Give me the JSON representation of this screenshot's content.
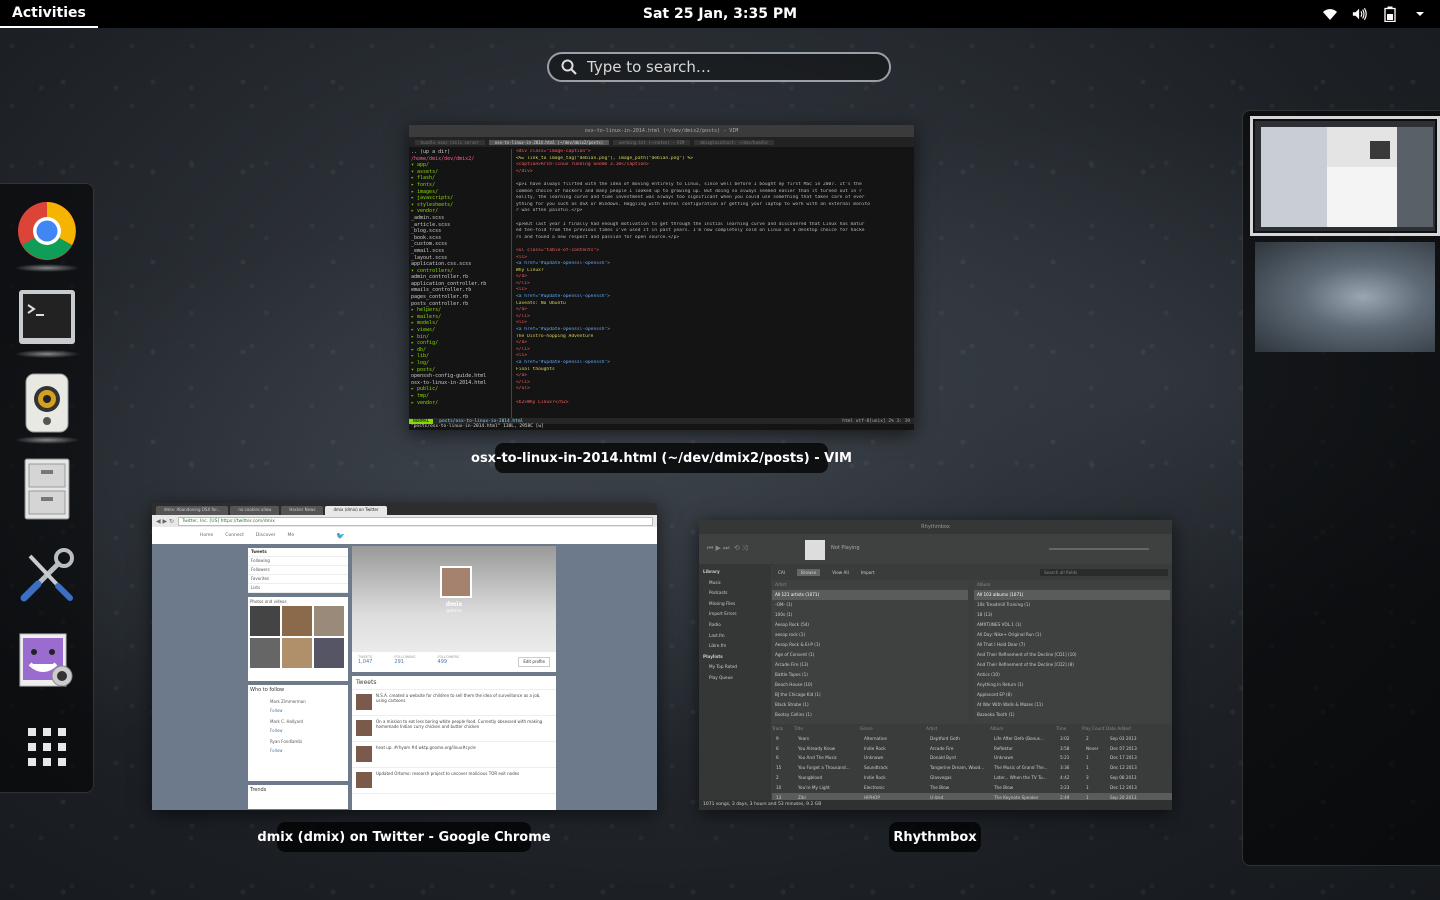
{
  "topbar": {
    "activities_label": "Activities",
    "clock": "Sat 25 Jan,  3:35 PM",
    "tray": [
      "network-wireless-icon",
      "volume-icon",
      "battery-icon",
      "menu-arrow-icon"
    ]
  },
  "search": {
    "placeholder": "Type to search…"
  },
  "dash": {
    "apps": [
      {
        "name": "Google Chrome",
        "icon": "chrome-icon",
        "running": true
      },
      {
        "name": "Terminal",
        "icon": "terminal-icon",
        "running": true
      },
      {
        "name": "Rhythmbox",
        "icon": "rhythmbox-icon",
        "running": true
      },
      {
        "name": "Files",
        "icon": "files-cabinet-icon",
        "running": false
      },
      {
        "name": "System Settings",
        "icon": "tools-icon",
        "running": false
      },
      {
        "name": "Cheese",
        "icon": "cheese-webcam-icon",
        "running": false
      }
    ],
    "show_apps_icon": "grid-icon"
  },
  "windows": {
    "vim": {
      "caption": "osx-to-linux-in-2014.html (~/dev/dmix2/posts) - VIM",
      "titlebar": "osx-to-linux-in-2014.html (~/dev/dmix2/posts) - VIM",
      "tabs": [
        "bundle exec rails server",
        "osx-to-linux-in-2014.html (~/dev/dmix2/posts)",
        "working.txt (~/notes) - VIM",
        "dmix@localhost: ~/dev/bundle"
      ],
      "tree": [
        {
          "t": ".. (up a dir)",
          "c": "f"
        },
        {
          "t": "/home/dmix/dev/dmix2/",
          "c": "t"
        },
        {
          "t": "▾ app/",
          "c": "d"
        },
        {
          "t": "  ▾ assets/",
          "c": "d"
        },
        {
          "t": "    ▸ flash/",
          "c": "d"
        },
        {
          "t": "    ▸ fonts/",
          "c": "d"
        },
        {
          "t": "    ▸ images/",
          "c": "d"
        },
        {
          "t": "    ▸ javascripts/",
          "c": "d"
        },
        {
          "t": "    ▾ stylesheets/",
          "c": "d"
        },
        {
          "t": "      ▸ vendor/",
          "c": "d"
        },
        {
          "t": "        _admin.scss",
          "c": "f"
        },
        {
          "t": "        _article.scss",
          "c": "f"
        },
        {
          "t": "        _blog.scss",
          "c": "f"
        },
        {
          "t": "        _book.scss",
          "c": "f"
        },
        {
          "t": "        _custom.scss",
          "c": "f"
        },
        {
          "t": "        _email.scss",
          "c": "f"
        },
        {
          "t": "        _layout.scss",
          "c": "f"
        },
        {
          "t": "        application.css.scss",
          "c": "f"
        },
        {
          "t": "  ▾ controllers/",
          "c": "d"
        },
        {
          "t": "      admin_controller.rb",
          "c": "f"
        },
        {
          "t": "      application_controller.rb",
          "c": "f"
        },
        {
          "t": "      emails_controller.rb",
          "c": "f"
        },
        {
          "t": "      pages_controller.rb",
          "c": "f"
        },
        {
          "t": "      posts_controller.rb",
          "c": "f"
        },
        {
          "t": "  ▸ helpers/",
          "c": "d"
        },
        {
          "t": "  ▸ mailers/",
          "c": "d"
        },
        {
          "t": "  ▸ models/",
          "c": "d"
        },
        {
          "t": "  ▸ views/",
          "c": "d"
        },
        {
          "t": "▸ bin/",
          "c": "d"
        },
        {
          "t": "▸ config/",
          "c": "d"
        },
        {
          "t": "▸ db/",
          "c": "d"
        },
        {
          "t": "▸ lib/",
          "c": "d"
        },
        {
          "t": "▸ log/",
          "c": "d"
        },
        {
          "t": "▾ posts/",
          "c": "d"
        },
        {
          "t": "    openssh-config-guide.html",
          "c": "f"
        },
        {
          "t": "    osx-to-linux-in-2014.html",
          "c": "f"
        },
        {
          "t": "▸ public/",
          "c": "d"
        },
        {
          "t": "▸ tmp/",
          "c": "d"
        },
        {
          "t": "▸ vendor/",
          "c": "d"
        }
      ],
      "code": [
        {
          "t": "<div class=\"image-caption\">",
          "c": "t"
        },
        {
          "t": "  <%= link_to image_tag(\"debian.png\"), image_path(\"debian.png\") %>",
          "c": "s"
        },
        {
          "t": "  <caption>Arch-linux running Gnome 3.10</caption>",
          "c": "t"
        },
        {
          "t": "</div>",
          "c": "t"
        },
        {
          "t": "",
          "c": ""
        },
        {
          "t": "<p>I have always flirted with the idea of moving entirely to Linux, since well before I bought my first Mac in 2007.  It's the",
          "c": ""
        },
        {
          "t": " common choice of hackers and many people I looked up to growing up. But doing so always seemed easier than it turned out in r",
          "c": ""
        },
        {
          "t": "eality, the learning curve and time investment was always too significant when you could use something that takes care of ever",
          "c": ""
        },
        {
          "t": "ything for you such as OSX or Windows. Haggling with kernel configuration or getting your laptop to work with an external monito",
          "c": ""
        },
        {
          "t": "r was often painful.</p>",
          "c": ""
        },
        {
          "t": "",
          "c": ""
        },
        {
          "t": "<p>But last year I finally had enough motivation to get through the initial learning curve and discovered that Linux has matur",
          "c": ""
        },
        {
          "t": "ed ten-fold from the previous times I've used it in past years. I'm now completely sold on Linux as a desktop choice for hacke",
          "c": ""
        },
        {
          "t": "rs and found a new respect and passion for open source.</p>",
          "c": ""
        },
        {
          "t": "",
          "c": ""
        },
        {
          "t": "<ul class=\"table-of-contents\">",
          "c": "t"
        },
        {
          "t": "  <li>",
          "c": "t"
        },
        {
          "t": "    <a href=\"#update-openssl-openssh\">",
          "c": "a"
        },
        {
          "t": "      Why Linux?",
          "c": "s"
        },
        {
          "t": "    </a>",
          "c": "t"
        },
        {
          "t": "  </li>",
          "c": "t"
        },
        {
          "t": "  <li>",
          "c": "t"
        },
        {
          "t": "    <a href=\"#update-openssl-openssh\">",
          "c": "a"
        },
        {
          "t": "      Caveats: No Ubuntu",
          "c": "s"
        },
        {
          "t": "    </a>",
          "c": "t"
        },
        {
          "t": "  </li>",
          "c": "t"
        },
        {
          "t": "  <li>",
          "c": "t"
        },
        {
          "t": "    <a href=\"#update-openssl-openssh\">",
          "c": "a"
        },
        {
          "t": "      The Distro-hopping Adventure",
          "c": "s"
        },
        {
          "t": "    </a>",
          "c": "t"
        },
        {
          "t": "  </li>",
          "c": "t"
        },
        {
          "t": "  <li>",
          "c": "t"
        },
        {
          "t": "    <a href=\"#update-openssl-openssh\">",
          "c": "a"
        },
        {
          "t": "      Final thoughts",
          "c": "s"
        },
        {
          "t": "    </a>",
          "c": "t"
        },
        {
          "t": "  </li>",
          "c": "t"
        },
        {
          "t": "</ul>",
          "c": "t"
        },
        {
          "t": "",
          "c": ""
        },
        {
          "t": "<h2>Why Linux?</h2>",
          "c": "t"
        }
      ],
      "status_mode": "NORMAL",
      "status_file": "posts/osx-to-linux-in-2014.html",
      "status_right": "html  utf-8[unix]  2%  3: 19",
      "cmdline": "\"posts/osx-to-linux-in-2014.html\" 138L, 2958C [w]"
    },
    "chrome": {
      "caption": "dmix (dmix) on Twitter - Google Chrome",
      "tabs": [
        "dmix: Abandoning OSX for...",
        "no cookies allow",
        "Hacker News",
        "dmix (dmix) on Twitter"
      ],
      "url": "Twitter, Inc. [US] https://twitter.com/dmix",
      "nav": [
        "Home",
        "Connect",
        "Discover",
        "Me"
      ],
      "sidebar": [
        "Tweets",
        "Following",
        "Followers",
        "Favorites",
        "Lists"
      ],
      "photos_label": "Photos and videos",
      "who_to_follow": "Who to follow",
      "follow_people": [
        "Mark Zimmerman",
        "Mark C. Hallyard",
        "Ryan Fondlambi"
      ],
      "follow_label": "Follow",
      "trends_label": "Trends",
      "profile_name": "dmix",
      "profile_handle": "@dmix",
      "stats": [
        {
          "label": "TWEETS",
          "value": "1,047"
        },
        {
          "label": "FOLLOWING",
          "value": "291"
        },
        {
          "label": "FOLLOWERS",
          "value": "499"
        }
      ],
      "edit_profile": "Edit profile",
      "tweets_label": "Tweets",
      "tweets": [
        "N.S.A. created a website for children to sell them the idea of surveillance as a job, using cartoons",
        "On a mission to eat less boring white people food. Currently obsessed with making homemade Indian curry chicken and butter chicken",
        "heat up. #rhyam #4 wktp.gnome.org/linux#cycle",
        "Updated Ortomo: research project to uncover malicious TOR exit nodes"
      ]
    },
    "rhythmbox": {
      "caption": "Rhythmbox",
      "titlebar": "Rhythmbox",
      "now_playing": "Not Playing",
      "library": [
        "Library",
        "Music",
        "Podcasts",
        "Missing Files",
        "Import Errors",
        "Radio",
        "Last.fm",
        "Libre.fm",
        "Playlists",
        "My Top Rated",
        "Play Queue"
      ],
      "browse_tabs": [
        "CAI",
        "Browse",
        "View All",
        "Import"
      ],
      "search_placeholder": "Search all fields",
      "artist_header": "Artist",
      "album_header": "Album",
      "artists": [
        "All 121 artists (1071)",
        "-OM- (1)",
        "100s (1)",
        "Aesop Rock (54)",
        "aesop rock (1)",
        "Aesop Rock & El-P (1)",
        "Age of Consent (1)",
        "Arcade Fire (13)",
        "Battle Tapes (1)",
        "Beach House (10)",
        "BJ the Chicago Kid (1)",
        "Black Strobe (1)",
        "Bootsy Collins (1)"
      ],
      "albums": [
        "All 103 albums (1071)",
        "10k Treadmill Training (1)",
        "18 (13)",
        "AMXTUNES VOL.1 (1)",
        "All Day: Nike+ Original Run (1)",
        "All That I Hold Dear (7)",
        "And Their Refinement of the Decline [CD1] (10)",
        "And Their Refinement of the Decline [CD2] (8)",
        "Antics (10)",
        "Anything In Return (1)",
        "Applecord EP (8)",
        "At War With Walls & Mazes (11)",
        "Bazooka Tooth (1)"
      ],
      "track_headers": [
        "Track",
        "Title",
        "Genre",
        "Artist",
        "Album",
        "Time",
        "Play Count",
        "Date Added"
      ],
      "tracks": [
        [
          "9",
          "Years",
          "Alternative",
          "Deptford Goth",
          "Life After Defo (Bonus...",
          "3:02",
          "2",
          "Sep 03 2013"
        ],
        [
          "6",
          "You Already Know",
          "Indie Rock",
          "Arcade Fire",
          "Reflektor",
          "3:58",
          "Never",
          "Dec 07 2013"
        ],
        [
          "6",
          "You And The Music",
          "Unknown",
          "Donald Byrd",
          "Unknown",
          "5:21",
          "1",
          "Dec 17 2013"
        ],
        [
          "15",
          "You Forget a Thousand...",
          "Soundtrack",
          "Tangerine Dream, Wood...",
          "The Music of Grand The...",
          "3:36",
          "1",
          "Dec 12 2013"
        ],
        [
          "2",
          "Youngblood",
          "Indie Rock",
          "Glasvegas",
          "Later... When the TV Tu...",
          "4:42",
          "3",
          "Sep 08 2013"
        ],
        [
          "10",
          "You're My Light",
          "Electronic",
          "The Blow",
          "The Blow",
          "3:23",
          "1",
          "Dec 12 2013"
        ],
        [
          "13",
          "Zibi",
          "HIPHOP",
          "U-Ized",
          "The Keynote Speaker",
          "2:49",
          "1",
          "Sep 20 2013"
        ]
      ],
      "footer": "1071 songs, 3 days, 3 hours and 53 minutes, 9.2 GB"
    }
  },
  "colors": {
    "accent": "#ffffff",
    "panel": "#000000"
  }
}
